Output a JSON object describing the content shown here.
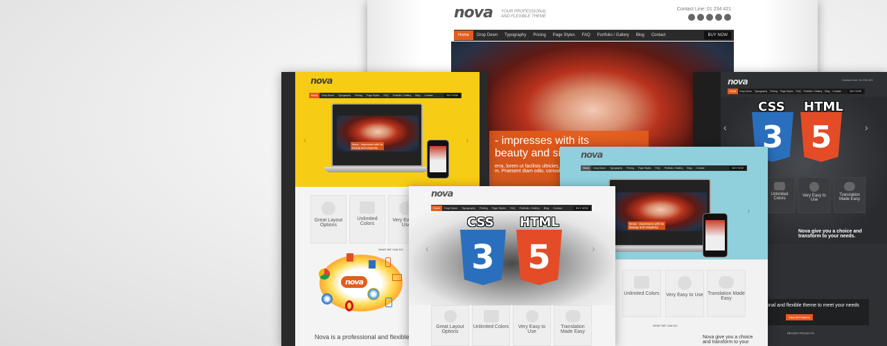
{
  "back_shot": {
    "logo": "nova",
    "tagline_1": "YOUR PROFESSIONAL",
    "tagline_2": "AND FLEXIBLE THEME",
    "contact": "Contact Line: 01 234 421",
    "nav": [
      "Home",
      "Drop Down",
      "Typography",
      "Pricing",
      "Page Styles",
      "FAQ",
      "Portfolio / Gallery",
      "Blog",
      "Contact"
    ],
    "buy": "BUY NOW",
    "hero_line_1": "- impresses with its",
    "hero_line_2": "beauty and simplicit",
    "hero_line_3": "erra, lorem ut facilisis ultricies, eros",
    "hero_line_4": "m. Praesent diam odio, convallis a"
  },
  "yellow_shot": {
    "logo": "nova",
    "nav": [
      "Home",
      "Drop Down",
      "Typography",
      "Pricing",
      "Page Styles",
      "FAQ",
      "Portfolio / Gallery",
      "Blog",
      "Contact"
    ],
    "buy": "BUY NOW",
    "features": [
      "Great Layout Options",
      "Unlimited Colors",
      "Very Easy to Use"
    ],
    "what_we_can_do": "WHAT WE CAN DO",
    "hub_logo": "nova",
    "footer_text": "Nova is a professional and flexible theme"
  },
  "dark_shot": {
    "logo": "nova",
    "contact": "Contact Line: 01 234 421",
    "nav": [
      "Home",
      "Drop Down",
      "Typography",
      "Pricing",
      "Page Styles",
      "FAQ",
      "Portfolio / Gallery",
      "Blog",
      "Contact"
    ],
    "buy": "BUY NOW",
    "css_label": "CSS",
    "html_label": "HTML",
    "css_num": "3",
    "html_num": "5",
    "features": [
      "Unlimited Colors",
      "Very Easy to Use",
      "Translation Made Easy"
    ],
    "nova_text": "Nova give you a choice and transform to your needs.",
    "bottom_text": "onal and flexible theme to meet your needs",
    "button": "View All Features",
    "recent": "RECENT PROJECTS"
  },
  "blue_shot": {
    "logo": "nova",
    "nav": [
      "Home",
      "Drop Down",
      "Typography",
      "Pricing",
      "Page Styles",
      "FAQ",
      "Portfolio / Gallery",
      "Blog",
      "Contact"
    ],
    "buy": "BUY NOW",
    "features": [
      "Unlimited Colors",
      "Very Easy to Use",
      "Translation Made Easy"
    ],
    "what_we_can_do": "WHAT WE CAN DO",
    "nova_text": "Nova give you a choice and transform to your"
  },
  "front_shot": {
    "logo": "nova",
    "nav": [
      "Home",
      "Drop Down",
      "Typography",
      "Pricing",
      "Page Styles",
      "FAQ",
      "Portfolio / Gallery",
      "Blog",
      "Contact"
    ],
    "buy": "BUY NOW",
    "css_label": "CSS",
    "html_label": "HTML",
    "css_num": "3",
    "html_num": "5",
    "features": [
      "Great Layout Options",
      "Unlimited Colors",
      "Very Easy to Use",
      "Translation Made Easy"
    ]
  },
  "laptop_screen": {
    "logo": "nova",
    "caption_1": "Nova - impresses with its",
    "caption_2": "beauty and simplicity"
  },
  "colors": {
    "accent": "#e35d1c",
    "yellow": "#f7cc14",
    "blue": "#8fd0dc",
    "dark": "#2f3033",
    "css_blue": "#2a6fbd",
    "html_orange": "#e34c26"
  }
}
